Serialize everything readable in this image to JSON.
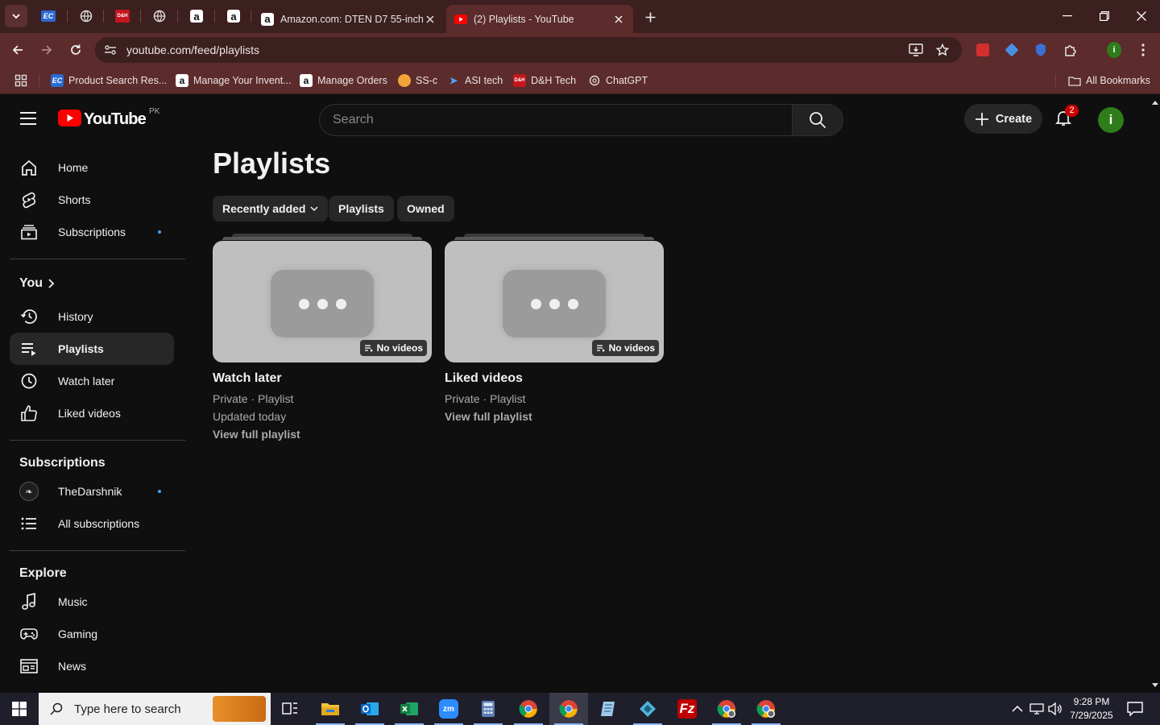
{
  "browser": {
    "tabs": [
      {
        "title": "Amazon.com: DTEN D7 55-inch",
        "active": false
      },
      {
        "title": "(2) Playlists - YouTube",
        "active": true
      }
    ],
    "url": "youtube.com/feed/playlists",
    "bookmarks": [
      {
        "label": "Product Search Res...",
        "icon": "ec-icon"
      },
      {
        "label": "Manage Your Invent...",
        "icon": "amazon-icon"
      },
      {
        "label": "Manage Orders",
        "icon": "amazon-icon"
      },
      {
        "label": "SS-c",
        "icon": "ss-icon"
      },
      {
        "label": "ASI tech",
        "icon": "asi-icon"
      },
      {
        "label": "D&H Tech",
        "icon": "dh-icon"
      },
      {
        "label": "ChatGPT",
        "icon": "chatgpt-icon"
      }
    ],
    "all_bookmarks": "All Bookmarks"
  },
  "youtube": {
    "logo_text": "YouTube",
    "country_code": "PK",
    "search_placeholder": "Search",
    "create_label": "Create",
    "notification_count": "2",
    "avatar_letter": "i",
    "sidebar": {
      "main": [
        {
          "label": "Home",
          "icon": "home-icon"
        },
        {
          "label": "Shorts",
          "icon": "shorts-icon"
        },
        {
          "label": "Subscriptions",
          "icon": "subscriptions-icon"
        }
      ],
      "you_header": "You",
      "you": [
        {
          "label": "History",
          "icon": "history-icon"
        },
        {
          "label": "Playlists",
          "icon": "playlists-icon",
          "active": true
        },
        {
          "label": "Watch later",
          "icon": "watch-later-icon"
        },
        {
          "label": "Liked videos",
          "icon": "liked-videos-icon"
        }
      ],
      "subscriptions_header": "Subscriptions",
      "subscriptions": [
        {
          "label": "TheDarshnik",
          "icon": "channel-avatar"
        },
        {
          "label": "All subscriptions",
          "icon": "list-icon"
        }
      ],
      "explore_header": "Explore",
      "explore": [
        {
          "label": "Music",
          "icon": "music-icon"
        },
        {
          "label": "Gaming",
          "icon": "gaming-icon"
        },
        {
          "label": "News",
          "icon": "news-icon"
        }
      ]
    },
    "main": {
      "title": "Playlists",
      "chips": [
        "Recently added",
        "Playlists",
        "Owned"
      ],
      "playlists": [
        {
          "name": "Watch later",
          "count": "No videos",
          "privacy": "Private · Playlist",
          "updated": "Updated today",
          "link": "View full playlist"
        },
        {
          "name": "Liked videos",
          "count": "No videos",
          "privacy": "Private · Playlist",
          "updated": "",
          "link": "View full playlist"
        }
      ]
    }
  },
  "taskbar": {
    "search_placeholder": "Type here to search",
    "time": "9:28 PM",
    "date": "7/29/2025",
    "apps": [
      "task-view-icon",
      "file-explorer-icon",
      "outlook-icon",
      "excel-icon",
      "zoom-icon",
      "calculator-icon",
      "chrome-icon",
      "chrome-icon",
      "notepad-icon",
      "app-icon",
      "filezilla-icon",
      "chrome-profile-icon",
      "chrome-profile-icon"
    ]
  },
  "colors": {
    "chrome_dark": "#3c1f1f",
    "chrome_toolbar": "#5c2b2b",
    "yt_background": "#0f0f0f",
    "yt_red": "#ff0000",
    "chip_bg": "#272727",
    "link_blue": "#3ea6ff"
  }
}
